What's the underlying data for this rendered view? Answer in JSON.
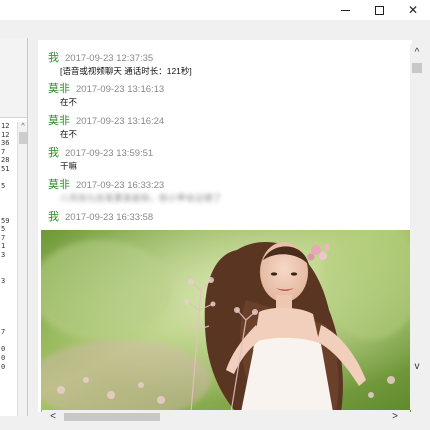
{
  "window_controls": {
    "minimize": "",
    "maximize": "",
    "close": "✕"
  },
  "left_list": {
    "items": [
      "12",
      "12",
      "36",
      "7",
      "28",
      "51",
      "",
      "5",
      "",
      "",
      "",
      "59",
      "5",
      "7",
      "1",
      "3",
      "",
      "",
      "3",
      "",
      "",
      "",
      "",
      "",
      "7",
      "",
      "0",
      "0",
      "0"
    ]
  },
  "messages": [
    {
      "sender": "我",
      "time": "2017-09-23 12:37:35",
      "body": "[语音或视频聊天  通话时长：121秒]",
      "blurred": false,
      "self": true
    },
    {
      "sender": "莫非",
      "time": "2017-09-23 13:16:13",
      "body": "在不",
      "blurred": false,
      "self": false
    },
    {
      "sender": "莫非",
      "time": "2017-09-23 13:16:24",
      "body": "在不",
      "blurred": false,
      "self": false
    },
    {
      "sender": "我",
      "time": "2017-09-23 13:59:51",
      "body": "干嘛",
      "blurred": false,
      "self": true
    },
    {
      "sender": "莫非",
      "time": "2017-09-23 16:33:23",
      "body": "八月份九份发票发给你，你小甲也记得了",
      "blurred": true,
      "self": false
    },
    {
      "sender": "我",
      "time": "2017-09-23 16:33:58",
      "body": "",
      "blurred": false,
      "self": true
    }
  ],
  "scrollbars": {
    "up": "^",
    "down": "v",
    "left": "<",
    "right": ">"
  }
}
